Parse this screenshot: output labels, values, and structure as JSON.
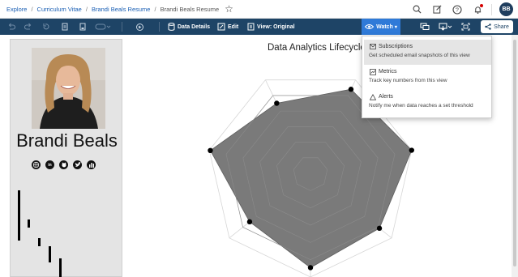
{
  "breadcrumb": {
    "items": [
      "Explore",
      "Curriculum Vitae",
      "Brandi Beals Resume",
      "Brandi Beals Resume"
    ],
    "separator": "/"
  },
  "user": {
    "initials": "BB"
  },
  "toolbar": {
    "data_details": "Data Details",
    "edit": "Edit",
    "view": "View: Original",
    "watch": "Watch",
    "share": "Share"
  },
  "watch_menu": {
    "items": [
      {
        "title": "Subscriptions",
        "description": "Get scheduled email snapshots of this view",
        "icon": "envelope-icon"
      },
      {
        "title": "Metrics",
        "description": "Track key numbers from this view",
        "icon": "metrics-icon"
      },
      {
        "title": "Alerts",
        "description": "Notify me when data reaches a set threshold",
        "icon": "alert-triangle-icon"
      }
    ]
  },
  "profile": {
    "name": "Brandi Beals",
    "socials": [
      "website-icon",
      "linkedin-icon",
      "github-icon",
      "twitter-icon",
      "tableau-public-icon"
    ]
  },
  "chart": {
    "title": "Data Analytics Lifecycle"
  },
  "chart_data": {
    "type": "radar",
    "title": "Data Analytics Lifecycle",
    "axes_count": 7,
    "values": [
      0.99,
      0.75,
      0.9,
      1.0,
      0.85,
      0.91,
      0.75
    ],
    "rmax": 1.0,
    "grid_rings": 6,
    "fill_color": "#7a7a7a",
    "point_color": "#000000"
  },
  "colors": {
    "toolbar_bg": "#1e4466",
    "accent": "#2f7ad8",
    "panel_bg": "#e4e4e4"
  }
}
